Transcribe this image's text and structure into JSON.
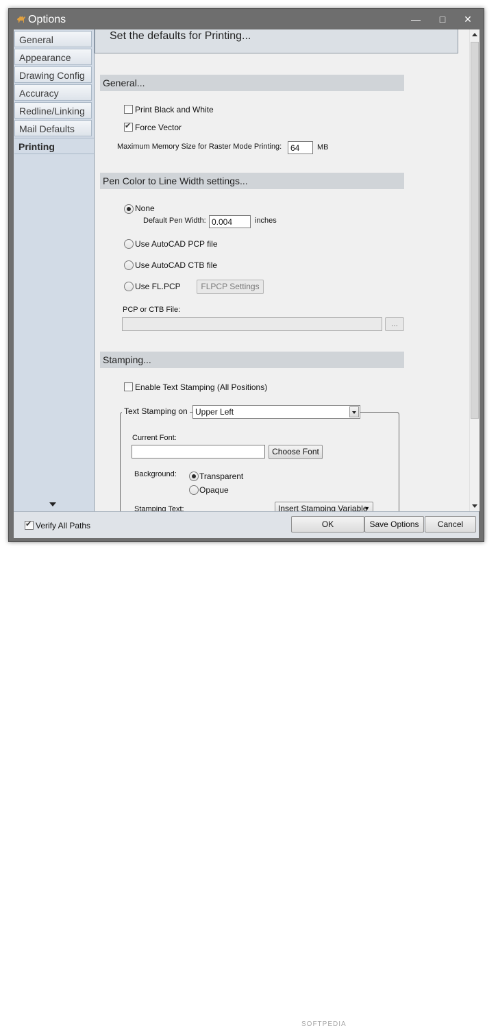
{
  "window": {
    "title": "Options"
  },
  "sidebar": {
    "items": [
      {
        "label": "General"
      },
      {
        "label": "Appearance"
      },
      {
        "label": "Drawing Config"
      },
      {
        "label": "Accuracy"
      },
      {
        "label": "Redline/Linking"
      },
      {
        "label": "Mail Defaults"
      },
      {
        "label": "Printing",
        "active": true
      }
    ]
  },
  "header": {
    "title": "Set the defaults for Printing..."
  },
  "general": {
    "section_title": "General...",
    "print_bw_label": "Print Black and White",
    "print_bw_checked": false,
    "force_vector_label": "Force Vector",
    "force_vector_checked": true,
    "max_memory_label": "Maximum Memory Size for Raster Mode Printing:",
    "max_memory_value": "64",
    "max_memory_unit": "MB"
  },
  "pen": {
    "section_title": "Pen Color to Line Width settings...",
    "none_label": "None",
    "default_pen_width_label": "Default Pen Width:",
    "default_pen_width_value": "0.004",
    "default_pen_width_unit": "inches",
    "pcp_label": "Use AutoCAD PCP file",
    "ctb_label": "Use AutoCAD CTB file",
    "flpcp_label": "Use FL.PCP",
    "flpcp_settings_button": "FLPCP Settings",
    "file_label": "PCP or CTB File:",
    "file_value": "",
    "browse_button": "...",
    "selected": "None"
  },
  "stamping": {
    "section_title": "Stamping...",
    "enable_label": "Enable Text Stamping (All Positions)",
    "enable_checked": false,
    "stamping_on_label": "Text Stamping on",
    "stamping_on_value": "Upper Left",
    "current_font_label": "Current Font:",
    "current_font_value": "",
    "choose_font_button": "Choose Font",
    "background_label": "Background:",
    "transparent_label": "Transparent",
    "opaque_label": "Opaque",
    "background_selected": "Transparent",
    "stamping_text_label": "Stamping Text:",
    "insert_variable_button": "Insert Stamping Variable"
  },
  "footer": {
    "verify_label": "Verify All Paths",
    "verify_checked": true,
    "ok_button": "OK",
    "save_button": "Save Options",
    "cancel_button": "Cancel",
    "watermark": "SOFTPEDIA"
  }
}
